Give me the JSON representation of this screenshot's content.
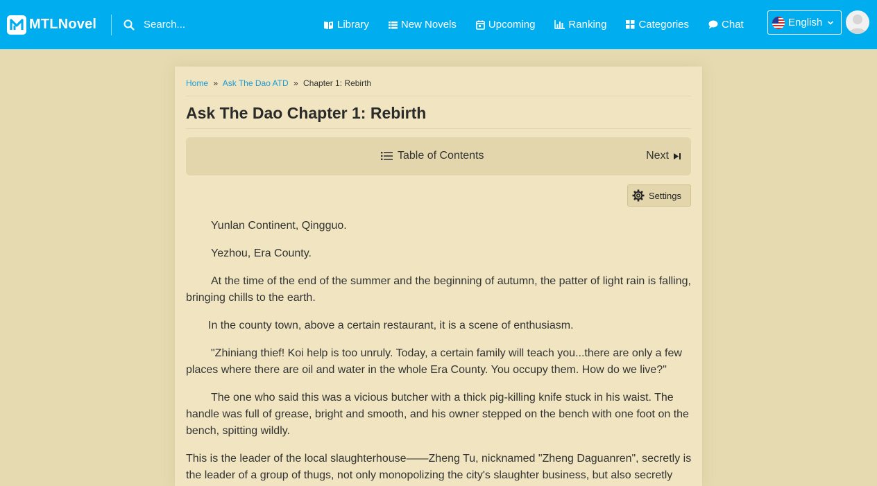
{
  "header": {
    "brand": "MTLNovel",
    "search_placeholder": "Search...",
    "nav": [
      {
        "label": "Library",
        "icon": "book-icon"
      },
      {
        "label": "New Novels",
        "icon": "list-icon"
      },
      {
        "label": "Upcoming",
        "icon": "calendar-icon"
      },
      {
        "label": "Ranking",
        "icon": "bar-chart-icon"
      },
      {
        "label": "Categories",
        "icon": "grid-icon"
      },
      {
        "label": "Chat",
        "icon": "chat-bubble-icon"
      }
    ],
    "language": "English",
    "colors": {
      "bar": "#00adef",
      "text": "#ffffff"
    }
  },
  "breadcrumb": {
    "home": "Home",
    "sep1": "»",
    "novel": "Ask The Dao ATD",
    "sep2": "»",
    "current": "Chapter 1: Rebirth"
  },
  "chapter": {
    "title": "Ask The Dao Chapter 1: Rebirth",
    "toc_label": "Table of Contents",
    "next_label": "Next",
    "settings_label": "Settings",
    "paragraphs": [
      "Yunlan Continent, Qingguo.",
      "Yezhou, Era County.",
      "At the time of the end of the summer and the beginning of autumn, the patter of light rain is falling, bringing chills to the earth.",
      "In the county town, above a certain restaurant, it is a scene of enthusiasm.",
      "\"Zhiniang thief! Koi help is too unruly. Today, a certain family will teach you...there are only a few places where there are oil and water in the whole Era County. You occupy them. How do we live?\"",
      "The one who said this was a vicious butcher with a thick pig-killing knife stuck in his waist. The handle was full of grease, bright and smooth, and his owner stepped on the bench with one foot on the bench, spitting wildly.",
      "This is the leader of the local slaughterhouse——Zheng Tu, nicknamed \"Zheng Daguanren\", secretly is the leader of a group of thugs, not only monopolizing the city's slaughter business, but also secretly"
    ]
  },
  "colors": {
    "page_bg": "#e6dab0",
    "paper_bg": "#f0e5c0",
    "link": "#1a9bd7",
    "nav_box": "#e3d6ac"
  }
}
